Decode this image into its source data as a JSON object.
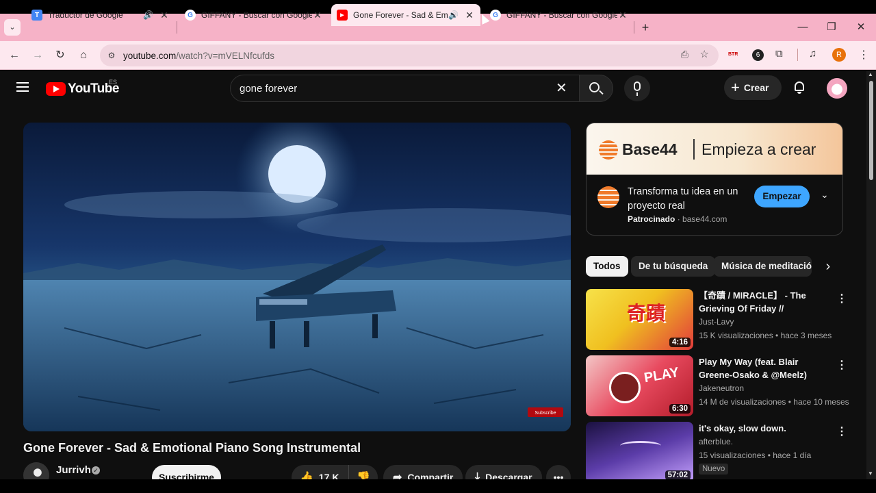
{
  "browser": {
    "tabs": [
      {
        "title": "Traductor de Google",
        "favicon": "T",
        "audio": true
      },
      {
        "title": "GIFFANY - Buscar con Google",
        "favicon": "G",
        "audio": false
      },
      {
        "title": "Gone Forever - Sad & Emot",
        "favicon": "▶",
        "audio": true
      },
      {
        "title": "GIFFANY - Buscar con Google",
        "favicon": "G",
        "audio": false
      }
    ],
    "url_host": "youtube.com",
    "url_path": "/watch?v=mVELNfcufds",
    "profile_initial": "R"
  },
  "youtube": {
    "logo_text": "YouTube",
    "logo_country": "ES",
    "search_value": "gone forever",
    "create_label": "Crear",
    "video": {
      "title": "Gone Forever - Sad & Emotional Piano Song Instrumental",
      "channel": "Jurrivh",
      "subscribe_label": "Suscribirme",
      "likes": "17 K",
      "share_label": "Compartir",
      "download_label": "Descargar",
      "watermark_label": "Subscribe"
    },
    "ad": {
      "brand": "Base44",
      "tagline": "Empieza a crear",
      "headline": "Transforma tu idea en un proyecto real",
      "sponsored": "Patrocinado",
      "domain": "base44.com",
      "cta": "Empezar"
    },
    "chips": [
      "Todos",
      "De tu búsqueda",
      "Música de meditación"
    ],
    "related": [
      {
        "title": "【奇蹟 / MIRACLE】 - The Grieving Of Friday // GAMEPLA...",
        "channel": "Just-Lavy",
        "meta": "15 K visualizaciones • hace 3 meses",
        "duration": "4:16",
        "thumb_text": "奇蹟"
      },
      {
        "title": "Play My Way (feat. Blair Greene-Osako & @Meelz)【Official ...",
        "channel": "Jakeneutron",
        "meta": "14 M de visualizaciones • hace 10 meses",
        "duration": "6:30",
        "thumb_text": "PLAY"
      },
      {
        "title": "it's okay, slow down.",
        "channel": "afterblue.",
        "meta": "15 visualizaciones • hace 1 día",
        "duration": "57:02",
        "badge": "Nuevo"
      }
    ]
  },
  "colors": {
    "tabbar": "#f6b2c7",
    "toolbar": "#fde8ef",
    "yt_bg": "#0f0f0f",
    "yt_red": "#ff0000",
    "ad_cta": "#3ea6ff"
  }
}
